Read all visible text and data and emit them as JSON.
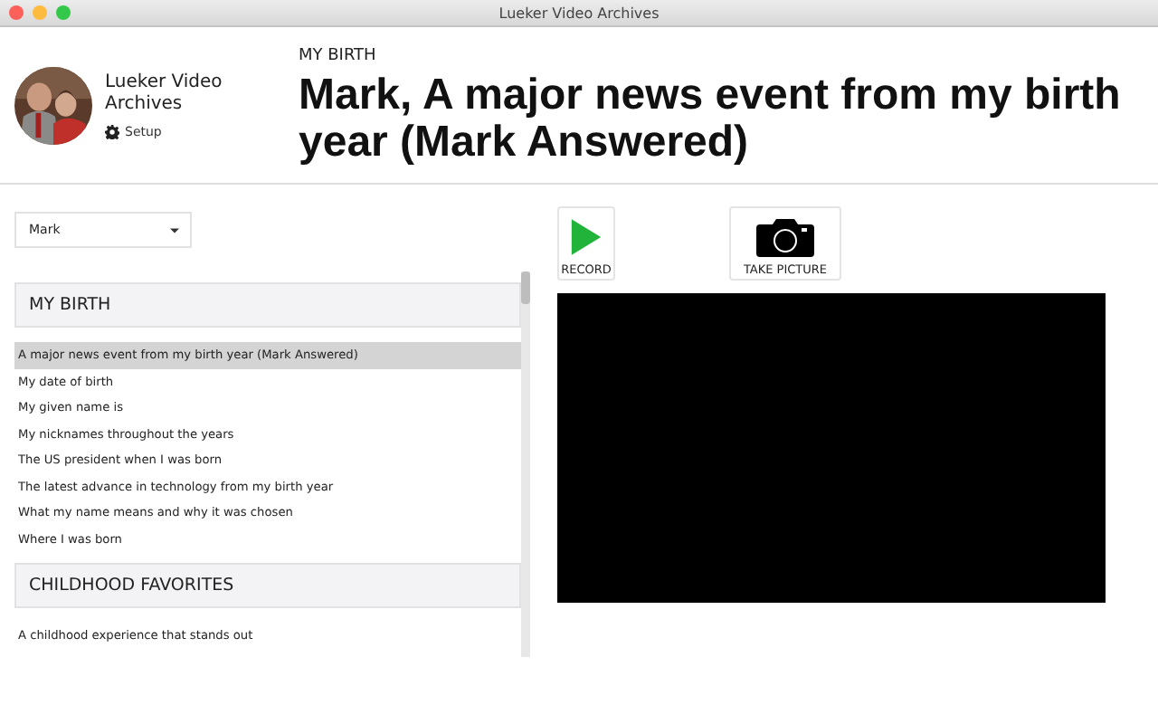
{
  "window": {
    "title": "Lueker Video Archives"
  },
  "brand": {
    "name": "Lueker Video Archives",
    "setup": "Setup"
  },
  "header": {
    "section": "MY BIRTH",
    "title": "Mark, A major news event from my birth year (Mark Answered)"
  },
  "person_select": {
    "value": "Mark"
  },
  "sections": [
    {
      "heading": "MY BIRTH",
      "items": [
        {
          "label": "A major news event from my birth year (Mark Answered)",
          "selected": true
        },
        {
          "label": "My date of birth",
          "selected": false
        },
        {
          "label": "My given name is",
          "selected": false
        },
        {
          "label": "My nicknames throughout the years",
          "selected": false
        },
        {
          "label": "The US president when I was born",
          "selected": false
        },
        {
          "label": "The latest advance in technology from my birth year",
          "selected": false
        },
        {
          "label": "What my name means and why it was chosen",
          "selected": false
        },
        {
          "label": "Where I was born",
          "selected": false
        }
      ]
    },
    {
      "heading": "CHILDHOOD FAVORITES",
      "items": [
        {
          "label": "A childhood experience that stands out",
          "selected": false
        }
      ]
    }
  ],
  "buttons": [
    {
      "kind": "record",
      "label": "RECORD"
    },
    {
      "kind": "camera",
      "label": "TAKE PICTURE"
    }
  ]
}
